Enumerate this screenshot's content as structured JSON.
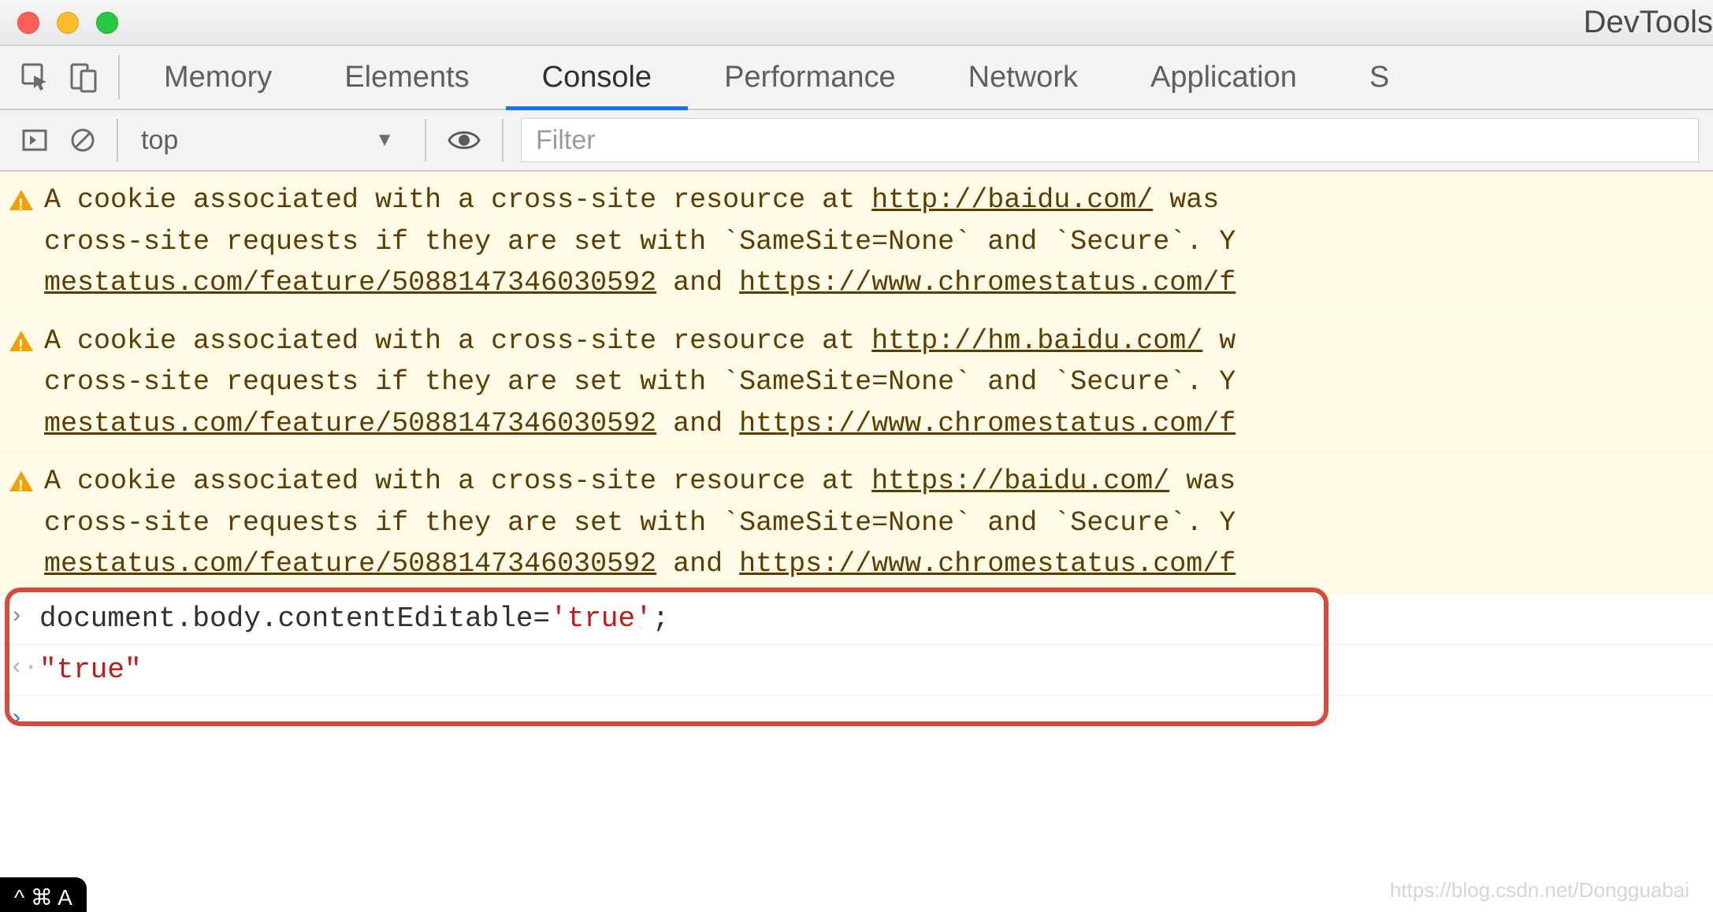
{
  "window": {
    "title": "DevTools"
  },
  "tabs": {
    "items": [
      "Memory",
      "Elements",
      "Console",
      "Performance",
      "Network",
      "Application",
      "S"
    ],
    "activeIndex": 2
  },
  "toolbar": {
    "context": "top",
    "filterPlaceholder": "Filter"
  },
  "warnings": [
    {
      "prefix": "A cookie associated with a cross-site resource at ",
      "url1": "http://baidu.com/",
      "mid1": " was",
      "line2a": "cross-site requests if they are set with `SameSite=None` and `Secure`. Y",
      "link2a": "mestatus.com/feature/5088147346030592",
      "mid2": " and ",
      "link2b": "https://www.chromestatus.com/f"
    },
    {
      "prefix": "A cookie associated with a cross-site resource at ",
      "url1": "http://hm.baidu.com/",
      "mid1": " w",
      "line2a": "cross-site requests if they are set with `SameSite=None` and `Secure`. Y",
      "link2a": "mestatus.com/feature/5088147346030592",
      "mid2": " and ",
      "link2b": "https://www.chromestatus.com/f"
    },
    {
      "prefix": "A cookie associated with a cross-site resource at ",
      "url1": "https://baidu.com/",
      "mid1": " was",
      "line2a": "cross-site requests if they are set with `SameSite=None` and `Secure`. Y",
      "link2a": "mestatus.com/feature/5088147346030592",
      "mid2": " and ",
      "link2b": "https://www.chromestatus.com/f"
    }
  ],
  "console": {
    "input1_a": "document.body.contentEditable=",
    "input1_b": "'true'",
    "input1_c": ";",
    "result1": "\"true\""
  },
  "badge": "^ ⌘ A",
  "watermark": "https://blog.csdn.net/Dongguabai"
}
